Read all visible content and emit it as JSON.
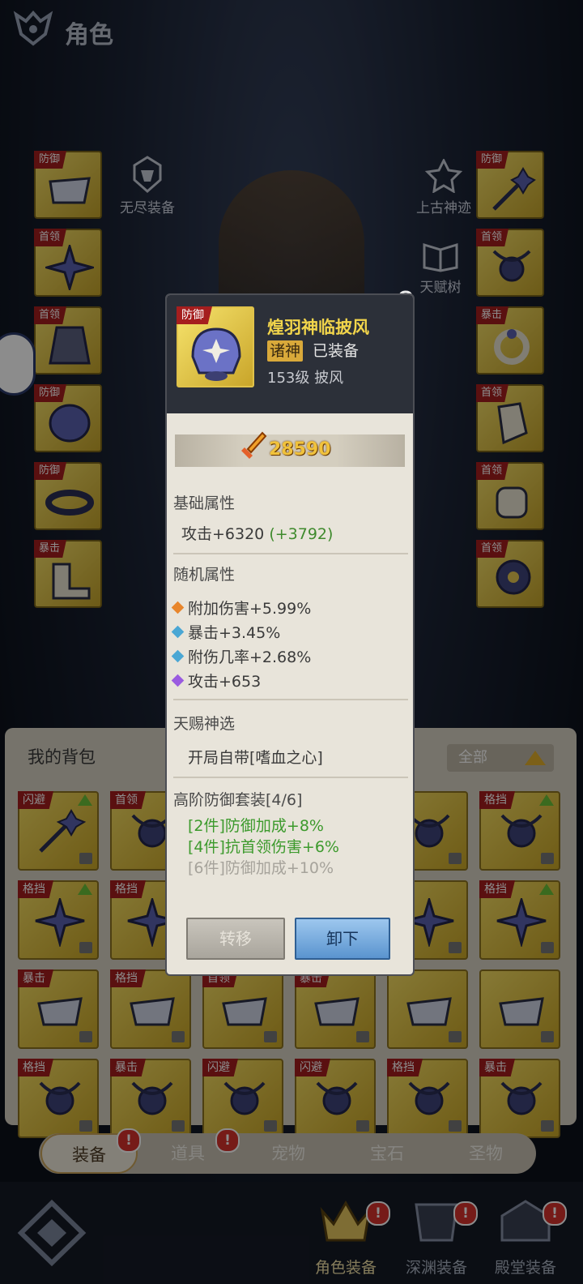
{
  "header": {
    "title": "角色"
  },
  "side_buttons": {
    "endless_equipment": "无尽装备",
    "ancient_relic": "上古神迹",
    "talent_tree": "天赋树"
  },
  "left_slots": [
    "防御",
    "首领",
    "首领",
    "防御",
    "防御",
    "暴击"
  ],
  "right_slots": [
    "防御",
    "首领",
    "暴击",
    "首领",
    "首领",
    "首领"
  ],
  "popup": {
    "tag": "防御",
    "name": "煌羽神临披风",
    "quality": "诸神",
    "equipped": "已装备",
    "level": "153级 披风",
    "power": "28590",
    "base_title": "基础属性",
    "base_stat": "攻击+6320",
    "base_bonus": "(+3792)",
    "random_title": "随机属性",
    "random_stats": [
      "附加伤害+5.99%",
      "暴击+3.45%",
      "附伤几率+2.68%",
      "攻击+653"
    ],
    "random_colors": [
      "#e8862c",
      "#4aa7d4",
      "#4aa7d4",
      "#9a5be0"
    ],
    "gift_title": "天赐神选",
    "gift_text": "开局自带[嗜血之心]",
    "set_title": "高阶防御套装[4/6]",
    "set_bonus_2": "[2件]防御加成+8%",
    "set_bonus_4": "[4件]抗首领伤害+6%",
    "set_bonus_6": "[6件]防御加成+10%",
    "transfer_button": "转移",
    "unequip_button": "卸下"
  },
  "bag": {
    "title": "我的背包",
    "filter": "全部",
    "rows": [
      [
        "闪避",
        "首领",
        "",
        "",
        "",
        "格挡"
      ],
      [
        "格挡",
        "格挡",
        "",
        "",
        "",
        "格挡"
      ],
      [
        "暴击",
        "格挡",
        "首领",
        "暴击",
        "",
        ""
      ],
      [
        "格挡",
        "暴击",
        "闪避",
        "闪避",
        "格挡",
        "暴击"
      ]
    ]
  },
  "tabs": [
    "装备",
    "道具",
    "宠物",
    "宝石",
    "圣物"
  ],
  "badge_mark": "!",
  "bottom_nav": [
    "角色装备",
    "深渊装备",
    "殿堂装备"
  ],
  "colors": {
    "accent_gold": "#f2d54b",
    "tag_red": "#a51e1e",
    "unequip_blue": "#5a94cf"
  }
}
